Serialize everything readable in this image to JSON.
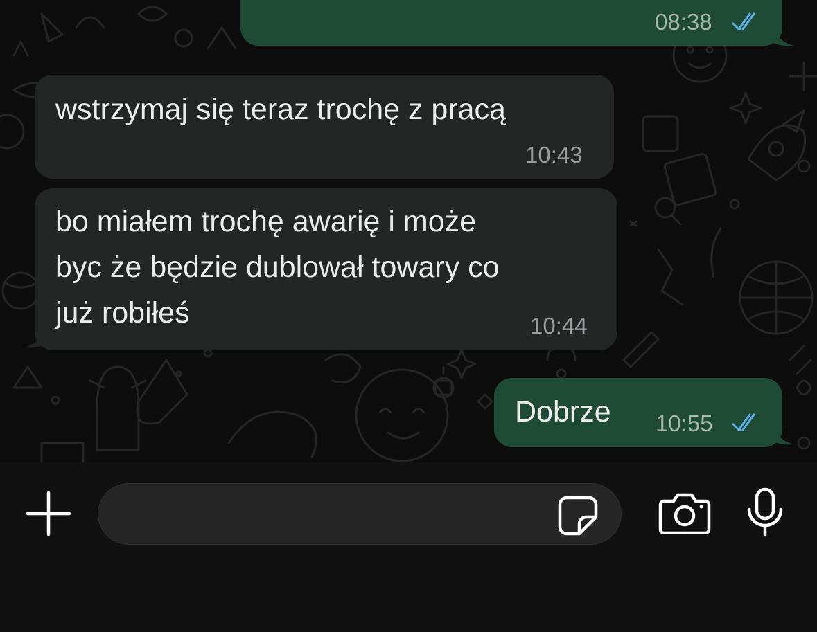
{
  "messages": [
    {
      "direction": "out",
      "text": "",
      "time": "08:38",
      "status": "read"
    },
    {
      "direction": "in",
      "text": "wstrzymaj się teraz trochę z pracą",
      "time": "10:43"
    },
    {
      "direction": "in",
      "text": "bo miałem trochę awarię i może\nbyc że będzie dublował towary co\njuż robiłeś",
      "time": "10:44"
    },
    {
      "direction": "out",
      "text": "Dobrze",
      "time": "10:55",
      "status": "read"
    }
  ],
  "composer": {
    "input_value": "",
    "placeholder": ""
  },
  "colors": {
    "incoming_bubble": "#242626",
    "outgoing_bubble": "#1f4a36",
    "read_ticks": "#5fb2e8",
    "background": "#0d0d0d"
  },
  "icons": {
    "attach": "plus-icon",
    "sticker": "sticker-icon",
    "camera": "camera-icon",
    "mic": "microphone-icon"
  }
}
